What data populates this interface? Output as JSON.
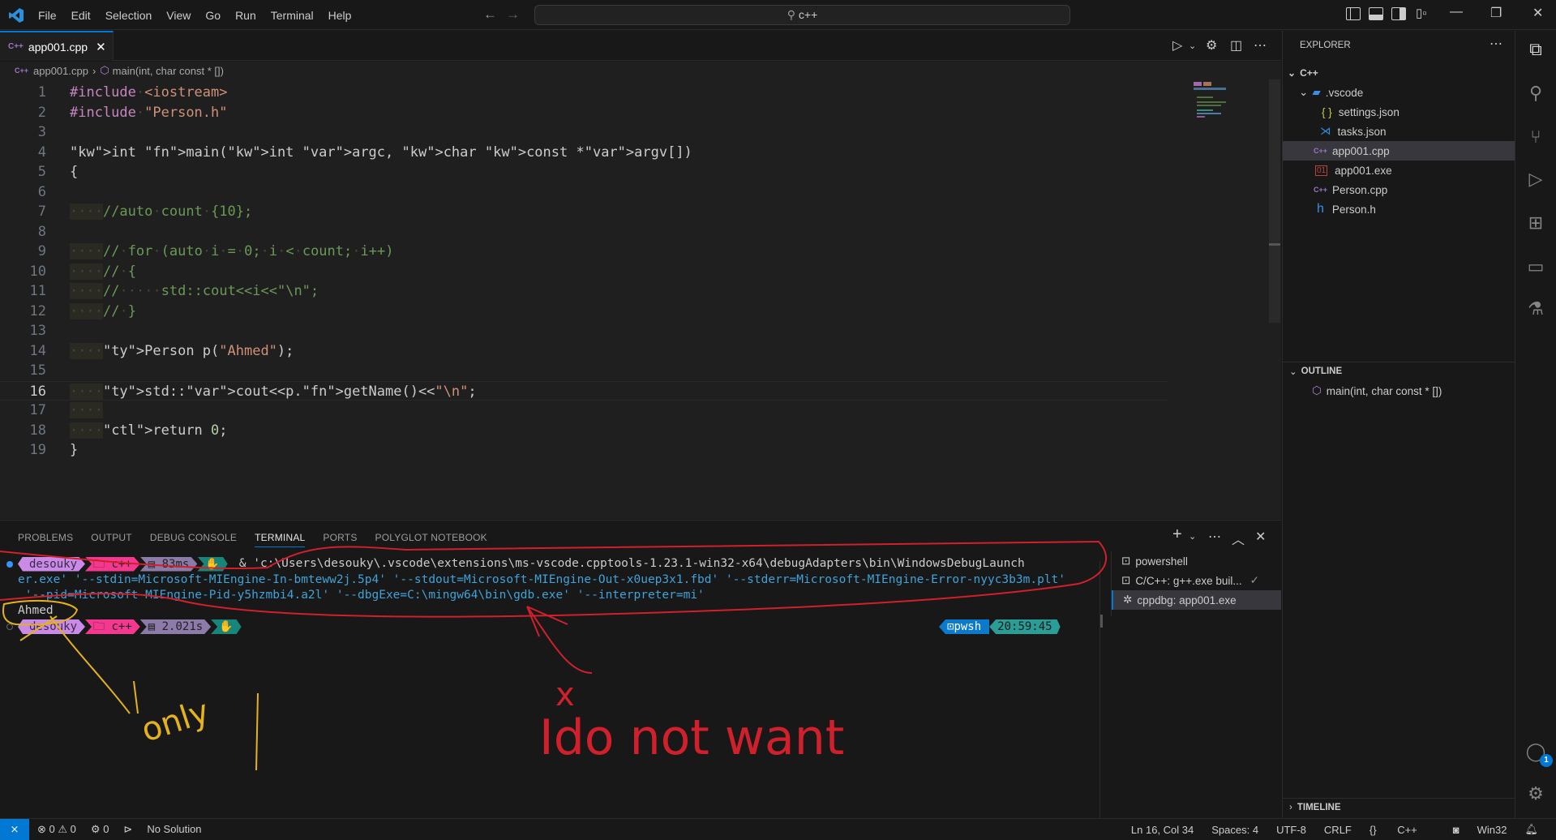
{
  "titlebar": {
    "menu": [
      "File",
      "Edit",
      "Selection",
      "View",
      "Go",
      "Run",
      "Terminal",
      "Help"
    ],
    "search_text": "c++"
  },
  "editor_tab": {
    "label": "app001.cpp",
    "icon": "C++"
  },
  "breadcrumb": {
    "file": "app001.cpp",
    "symbol": "main(int, char const * [])"
  },
  "code": {
    "current_line": 16,
    "lines": [
      "#include <iostream>",
      "#include \"Person.h\"",
      "",
      "int main(int argc, char const *argv[])",
      "{",
      "",
      "    //auto count {10};",
      "",
      "    // for (auto i = 0; i < count; i++)",
      "    // {",
      "    //     std::cout<<i<<\"\\n\";",
      "    // }",
      "",
      "    Person p(\"Ahmed\");",
      "",
      "    std::cout<<p.getName()<<\"\\n\";",
      "    ",
      "    return 0;",
      "}"
    ]
  },
  "panel": {
    "tabs": [
      "PROBLEMS",
      "OUTPUT",
      "DEBUG CONSOLE",
      "TERMINAL",
      "PORTS",
      "POLYGLOT NOTEBOOK"
    ],
    "active_tab": "TERMINAL",
    "prompt1": {
      "user": "desouky",
      "dir": "c++",
      "time": "83ms"
    },
    "command_lines": [
      "& 'c:\\Users\\desouky\\.vscode\\extensions\\ms-vscode.cpptools-1.23.1-win32-x64\\debugAdapters\\bin\\WindowsDebugLaunch",
      "er.exe' '--stdin=Microsoft-MIEngine-In-bmteww2j.5p4' '--stdout=Microsoft-MIEngine-Out-x0uep3x1.fbd' '--stderr=Microsoft-MIEngine-Error-nyyc3b3m.plt'",
      " '--pid=Microsoft-MIEngine-Pid-y5hzmbi4.a2l' '--dbgExe=C:\\mingw64\\bin\\gdb.exe' '--interpreter=mi'"
    ],
    "output": "Ahmed",
    "prompt2": {
      "user": "desouky",
      "dir": "c++",
      "time": "2.021s"
    },
    "right_prompt": {
      "shell": "pwsh",
      "clock": "20:59:45"
    },
    "terminals": [
      {
        "name": "powershell",
        "icon": "terminal-icon"
      },
      {
        "name": "C/C++: g++.exe buil...",
        "icon": "terminal-icon",
        "status": "✓"
      },
      {
        "name": "cppdbg: app001.exe",
        "icon": "debug-icon",
        "selected": true
      }
    ]
  },
  "annotations": {
    "yellow_text": "only",
    "red_text": "Ido not want",
    "red_mark": "x"
  },
  "explorer": {
    "title": "EXPLORER",
    "root": "C++",
    "items": [
      {
        "name": ".vscode",
        "type": "folder"
      },
      {
        "name": "settings.json",
        "type": "json"
      },
      {
        "name": "tasks.json",
        "type": "vscode"
      },
      {
        "name": "app001.cpp",
        "type": "cpp",
        "selected": true
      },
      {
        "name": "app001.exe",
        "type": "exe"
      },
      {
        "name": "Person.cpp",
        "type": "cpp"
      },
      {
        "name": "Person.h",
        "type": "h"
      }
    ],
    "outline_title": "OUTLINE",
    "outline_item": "main(int, char const * [])",
    "timeline_title": "TIMELINE"
  },
  "activity": {
    "account_badge": "1"
  },
  "status": {
    "errors": "0",
    "warnings": "0",
    "ports": "0",
    "solution": "No Solution",
    "position": "Ln 16, Col 34",
    "spaces": "Spaces: 4",
    "encoding": "UTF-8",
    "eol": "CRLF",
    "language": "C++",
    "platform": "Win32"
  }
}
